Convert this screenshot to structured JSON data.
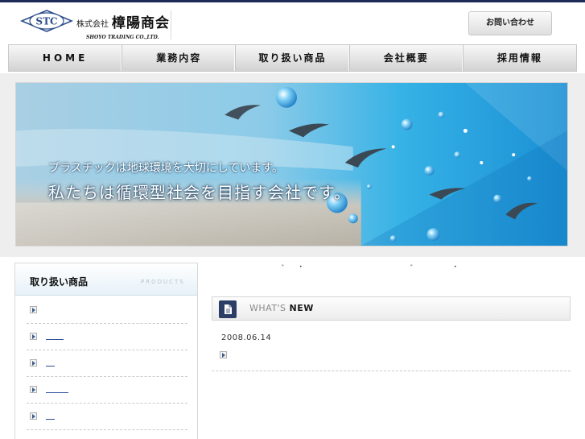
{
  "header": {
    "logo_mark": "STC",
    "company_type": "株式会社",
    "company_name": "樟陽商会",
    "company_en": "SHOYO TRADING CO.,LTD.",
    "contact_label": "お問い合わせ"
  },
  "nav": {
    "items": [
      {
        "label": "HOME"
      },
      {
        "label": "業務内容"
      },
      {
        "label": "取り扱い商品"
      },
      {
        "label": "会社概要"
      },
      {
        "label": "採用情報"
      }
    ]
  },
  "banner": {
    "line1": "プラスチックは地球環境を大切にしています。",
    "line2": "私たちは循環型社会を目指す会社です。"
  },
  "sidebar": {
    "title": "取り扱い商品",
    "subtitle": "PRODUCTS",
    "items": [
      {
        "label": ""
      },
      {
        "label": ""
      },
      {
        "label": ""
      },
      {
        "label": ""
      },
      {
        "label": ""
      }
    ]
  },
  "news": {
    "title_prefix": "WHAT'S ",
    "title_bold": "NEW",
    "entries": [
      {
        "date": "2008.06.14"
      }
    ]
  },
  "colors": {
    "top_line": "#1c2a55",
    "link": "#2a4f9a",
    "news_icon": "#2d3e66"
  }
}
